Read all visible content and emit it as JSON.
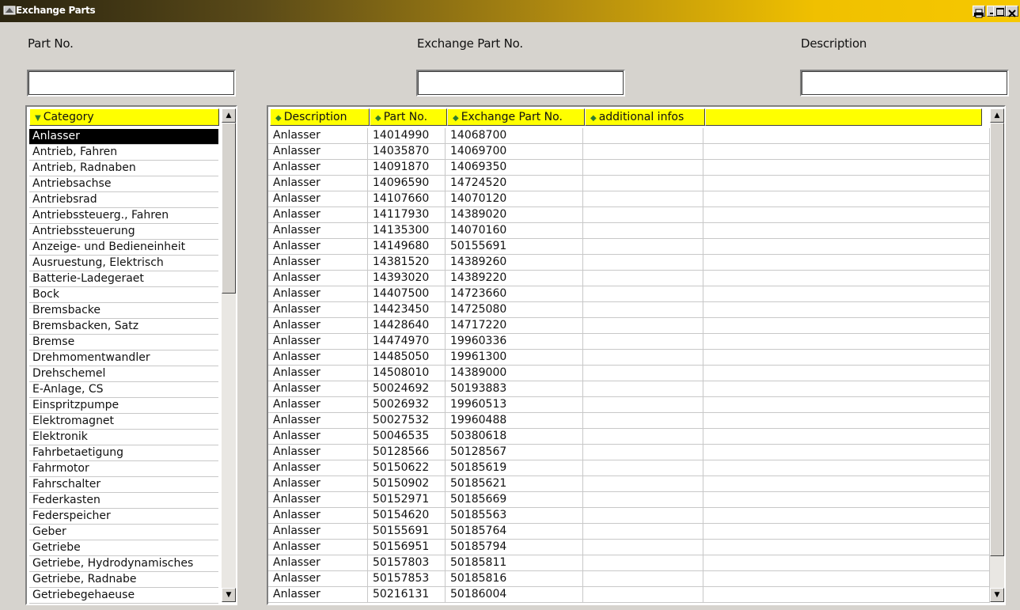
{
  "window": {
    "title": "Exchange Parts"
  },
  "filters": {
    "part_no": {
      "label": "Part No.",
      "value": "",
      "placeholder": ""
    },
    "exchange_part_no": {
      "label": "Exchange Part No.",
      "value": "",
      "placeholder": ""
    },
    "description": {
      "label": "Description",
      "value": "",
      "placeholder": ""
    }
  },
  "category_list": {
    "header": "Category",
    "selected": "Anlasser",
    "items": [
      "Anlasser",
      "Antrieb, Fahren",
      "Antrieb, Radnaben",
      "Antriebsachse",
      "Antriebsrad",
      "Antriebssteuerg., Fahren",
      "Antriebssteuerung",
      "Anzeige- und Bedieneinheit",
      "Ausruestung, Elektrisch",
      "Batterie-Ladegeraet",
      "Bock",
      "Bremsbacke",
      "Bremsbacken, Satz",
      "Bremse",
      "Drehmomentwandler",
      "Drehschemel",
      "E-Anlage, CS",
      "Einspritzpumpe",
      "Elektromagnet",
      "Elektronik",
      "Fahrbetaetigung",
      "Fahrmotor",
      "Fahrschalter",
      "Federkasten",
      "Federspeicher",
      "Geber",
      "Getriebe",
      "Getriebe, Hydrodynamisches",
      "Getriebe, Radnabe",
      "Getriebegehaeuse"
    ]
  },
  "grid": {
    "columns": [
      "Description",
      "Part No.",
      "Exchange Part No.",
      "additional infos",
      ""
    ],
    "rows": [
      [
        "Anlasser",
        "14014990",
        "14068700",
        "",
        ""
      ],
      [
        "Anlasser",
        "14035870",
        "14069700",
        "",
        ""
      ],
      [
        "Anlasser",
        "14091870",
        "14069350",
        "",
        ""
      ],
      [
        "Anlasser",
        "14096590",
        "14724520",
        "",
        ""
      ],
      [
        "Anlasser",
        "14107660",
        "14070120",
        "",
        ""
      ],
      [
        "Anlasser",
        "14117930",
        "14389020",
        "",
        ""
      ],
      [
        "Anlasser",
        "14135300",
        "14070160",
        "",
        ""
      ],
      [
        "Anlasser",
        "14149680",
        "50155691",
        "",
        ""
      ],
      [
        "Anlasser",
        "14381520",
        "14389260",
        "",
        ""
      ],
      [
        "Anlasser",
        "14393020",
        "14389220",
        "",
        ""
      ],
      [
        "Anlasser",
        "14407500",
        "14723660",
        "",
        ""
      ],
      [
        "Anlasser",
        "14423450",
        "14725080",
        "",
        ""
      ],
      [
        "Anlasser",
        "14428640",
        "14717220",
        "",
        ""
      ],
      [
        "Anlasser",
        "14474970",
        "19960336",
        "",
        ""
      ],
      [
        "Anlasser",
        "14485050",
        "19961300",
        "",
        ""
      ],
      [
        "Anlasser",
        "14508010",
        "14389000",
        "",
        ""
      ],
      [
        "Anlasser",
        "50024692",
        "50193883",
        "",
        ""
      ],
      [
        "Anlasser",
        "50026932",
        "19960513",
        "",
        ""
      ],
      [
        "Anlasser",
        "50027532",
        "19960488",
        "",
        ""
      ],
      [
        "Anlasser",
        "50046535",
        "50380618",
        "",
        ""
      ],
      [
        "Anlasser",
        "50128566",
        "50128567",
        "",
        ""
      ],
      [
        "Anlasser",
        "50150622",
        "50185619",
        "",
        ""
      ],
      [
        "Anlasser",
        "50150902",
        "50185621",
        "",
        ""
      ],
      [
        "Anlasser",
        "50152971",
        "50185669",
        "",
        ""
      ],
      [
        "Anlasser",
        "50154620",
        "50185563",
        "",
        ""
      ],
      [
        "Anlasser",
        "50155691",
        "50185764",
        "",
        ""
      ],
      [
        "Anlasser",
        "50156951",
        "50185794",
        "",
        ""
      ],
      [
        "Anlasser",
        "50157803",
        "50185811",
        "",
        ""
      ],
      [
        "Anlasser",
        "50157853",
        "50185816",
        "",
        ""
      ],
      [
        "Anlasser",
        "50216131",
        "50186004",
        "",
        ""
      ]
    ]
  },
  "colors": {
    "header_bg": "#ffff00",
    "selection_bg": "#000000",
    "window_bg": "#d6d3ce"
  }
}
